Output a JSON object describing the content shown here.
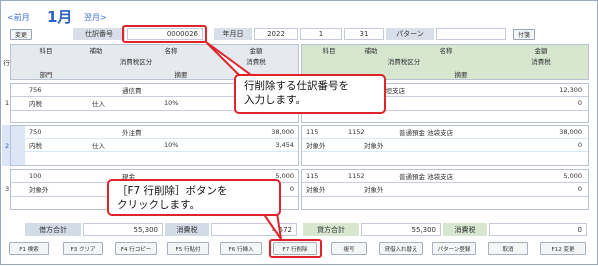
{
  "nav": {
    "prev": "<前月",
    "month": "1月",
    "next": "翌月>"
  },
  "toolbar": {
    "change_btn": "変更",
    "attach_btn": "付箋"
  },
  "header_fields": {
    "voucher_no_label": "仕訳番号",
    "voucher_no": "0000026",
    "date_label": "年月日",
    "year": "2022",
    "month": "1",
    "day": "31",
    "pattern_label": "パターン"
  },
  "col_headers": {
    "row": "行",
    "debit": {
      "code": "科目",
      "sub": "補助",
      "name": "名称",
      "amount": "金額",
      "tax_class": "消費税区分",
      "tax": "消費税"
    },
    "dept": "部門",
    "memo": "摘要",
    "credit": {
      "code": "科目",
      "sub": "補助",
      "name": "名称",
      "amount": "金額",
      "tax_class": "消費税区分",
      "tax": "消費税"
    },
    "credit_memo": "摘要"
  },
  "rows": [
    {
      "no": "1",
      "d_code": "756",
      "d_sub": "",
      "d_name": "通信費",
      "d_amount": "",
      "d_tax_type": "内税",
      "d_tax_kind": "仕入",
      "d_rate": "10%",
      "d_tax": "",
      "c_code": "",
      "c_sub": "",
      "c_name": "預金 大垣支店",
      "c_amount": "12,300",
      "c_tax_type": "",
      "c_tax_kind": "",
      "c_tax": "0"
    },
    {
      "no": "2",
      "d_code": "750",
      "d_sub": "",
      "d_name": "外注費",
      "d_amount": "38,000",
      "d_tax_type": "内税",
      "d_tax_kind": "仕入",
      "d_rate": "10%",
      "d_tax": "3,454",
      "c_code": "115",
      "c_sub": "1152",
      "c_name": "普通預金 池袋支店",
      "c_amount": "38,000",
      "c_tax_type": "対象外",
      "c_tax_kind": "対象外",
      "c_tax": "0"
    },
    {
      "no": "3",
      "d_code": "100",
      "d_sub": "",
      "d_name": "現金",
      "d_amount": "5,000",
      "d_tax_type": "対象外",
      "d_tax_kind": "",
      "d_rate": "",
      "d_tax": "0",
      "c_code": "115",
      "c_sub": "1152",
      "c_name": "普通預金 池袋支店",
      "c_amount": "5,000",
      "c_tax_type": "対象外",
      "c_tax_kind": "対象外",
      "c_tax": "0"
    }
  ],
  "totals": {
    "debit_label": "借方合計",
    "debit_total": "55,300",
    "debit_tax_label": "消費税",
    "debit_tax": "4,572",
    "credit_label": "貸方合計",
    "credit_total": "55,300",
    "credit_tax_label": "消費税",
    "credit_tax": "0"
  },
  "fkeys": [
    "F1 検索",
    "F3 クリア",
    "F4 行コピー",
    "F5 行貼付",
    "F6 行挿入",
    "F7 行削除",
    "複写",
    "貸借入れ替え",
    "パターン登録",
    "取消",
    "F12 変更"
  ],
  "callouts": {
    "top_line1": "行削除する仕訳番号を",
    "top_line2": "入力します。",
    "bottom_line1": "［F7  行削除］ボタンを",
    "bottom_line2": "クリックします。"
  },
  "colors": {
    "accent": "#2a62c8",
    "callout_border": "#e0242c",
    "debit_header": "#e6e9ee",
    "credit_header": "#d6e6cf"
  }
}
